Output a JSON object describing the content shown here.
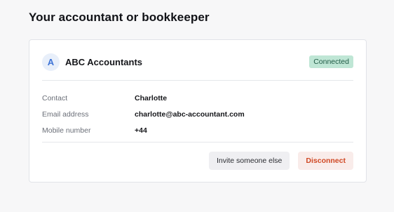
{
  "page": {
    "title": "Your accountant or bookkeeper"
  },
  "accountant": {
    "avatar_initial": "A",
    "name": "ABC Accountants",
    "status": "Connected",
    "details": [
      {
        "label": "Contact",
        "value": "Charlotte"
      },
      {
        "label": "Email address",
        "value": "charlotte@abc-accountant.com"
      },
      {
        "label": "Mobile number",
        "value": "+44"
      }
    ]
  },
  "actions": {
    "invite_label": "Invite someone else",
    "disconnect_label": "Disconnect"
  },
  "colors": {
    "background": "#f7f7f8",
    "status_badge_bg": "#bfe6d5",
    "avatar_bg": "#e8effa",
    "avatar_text": "#3f74d6",
    "danger_text": "#d04824",
    "danger_bg": "#f9ecea"
  }
}
